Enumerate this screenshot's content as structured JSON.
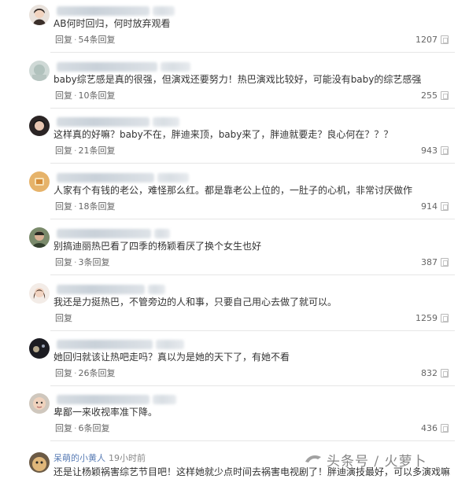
{
  "comments": [
    {
      "avatar": "avatar-girl-icon",
      "username": "",
      "text": "AB何时回归，何时放弃观看",
      "reply_label": "回复",
      "replies": "54条回复",
      "likes": "1207"
    },
    {
      "avatar": "avatar-blurred-icon",
      "username": "",
      "text": "baby综艺感是真的很强，但演戏还要努力！热巴演戏比较好，可能没有baby的综艺感强",
      "reply_label": "回复",
      "replies": "10条回复",
      "likes": "255"
    },
    {
      "avatar": "avatar-dark-hair-icon",
      "username": "",
      "text": "这样真的好嘛？baby不在，胖迪来顶，baby来了，胖迪就要走？良心何在？？？",
      "reply_label": "回复",
      "replies": "21条回复",
      "likes": "943"
    },
    {
      "avatar": "avatar-orange-icon",
      "username": "",
      "text": "人家有个有钱的老公，难怪那么红。都是靠老公上位的，一肚子的心机，非常讨厌做作",
      "reply_label": "回复",
      "replies": "18条回复",
      "likes": "914"
    },
    {
      "avatar": "avatar-man-icon",
      "username": "",
      "text": "别搞迪丽热巴看了四季的杨颖看厌了换个女生也好",
      "reply_label": "回复",
      "replies": "3条回复",
      "likes": "387"
    },
    {
      "avatar": "avatar-woman-icon",
      "username": "",
      "text": "我还是力挺热巴，不管旁边的人和事，只要自己用心去做了就可以。",
      "reply_label": "回复",
      "replies": "",
      "likes": "1259"
    },
    {
      "avatar": "avatar-night-icon",
      "username": "",
      "text": "她回归就该让热吧走吗？真以为是她的天下了，有她不看",
      "reply_label": "回复",
      "replies": "26条回复",
      "likes": "832"
    },
    {
      "avatar": "avatar-face-icon",
      "username": "",
      "text": "卑鄙一来收视率准下降。",
      "reply_label": "回复",
      "replies": "6条回复",
      "likes": "436"
    }
  ],
  "last_comment": {
    "avatar": "avatar-bear-icon",
    "username": "呆萌的小黄人",
    "time": "19小时前",
    "text": "还是让杨颖祸害综艺节目吧！这样她就少点时间去祸害电视剧了！胖迪演技最好，可以多演戏嘛"
  },
  "watermark": "头条号 / 火萝卜"
}
